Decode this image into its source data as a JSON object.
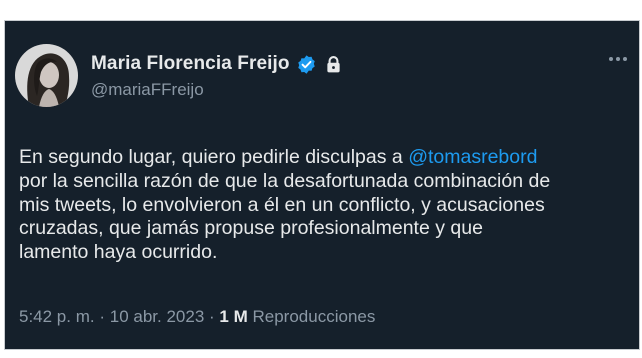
{
  "tweet": {
    "display_name": "Maria Florencia Freijo",
    "handle": "@mariaFFreijo",
    "verified": true,
    "protected": true,
    "text_lines": [
      {
        "before": "En segundo lugar, quiero pedirle disculpas a ",
        "mention": "@tomasrebord"
      },
      {
        "text": "por la sencilla razón de que la desafortunada combinación de"
      },
      {
        "text": "mis tweets, lo envolvieron a él en un conflicto, y acusaciones"
      },
      {
        "text": "cruzadas, que jamás propuse profesionalmente y que"
      },
      {
        "text": "lamento haya ocurrido."
      }
    ],
    "time": "5:42 p. m.",
    "separator": "·",
    "date": "10 abr. 2023",
    "views_count": "1 M",
    "views_label": "Reproducciones"
  },
  "icons": {
    "verified": "verified-badge-icon",
    "lock": "lock-icon",
    "more": "more-options-icon",
    "avatar": "profile-photo"
  },
  "colors": {
    "background": "#15202b",
    "text": "#e7e9ea",
    "secondary_text": "#8b98a5",
    "accent": "#1d9bf0"
  }
}
